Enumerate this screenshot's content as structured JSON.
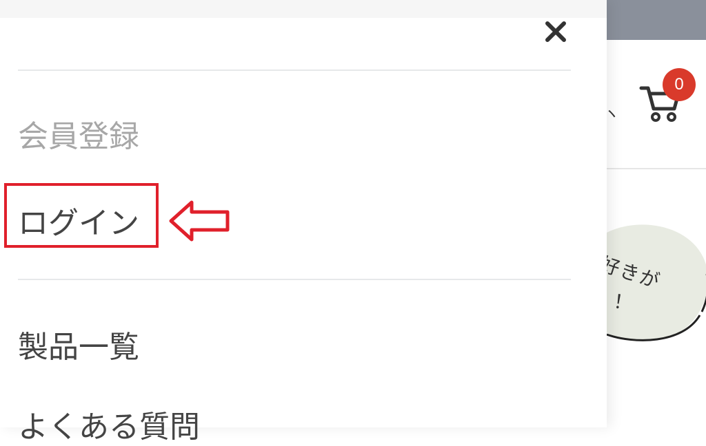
{
  "drawer": {
    "close_label": "×",
    "menu": {
      "register": "会員登録",
      "login": "ログイン",
      "products": "製品一覧",
      "faq": "よくある質問"
    }
  },
  "background": {
    "cart_count": "0",
    "bubble_text_1": "好きが",
    "bubble_text_2": "！"
  },
  "colors": {
    "topbar": "#8a909b",
    "badge": "#d93a2b",
    "highlight": "#e0202b",
    "muted_text": "#a7a7a7",
    "text": "#444444"
  },
  "icons": {
    "close": "close-icon",
    "cart": "cart-icon",
    "annotation_arrow": "arrow-left-icon"
  }
}
